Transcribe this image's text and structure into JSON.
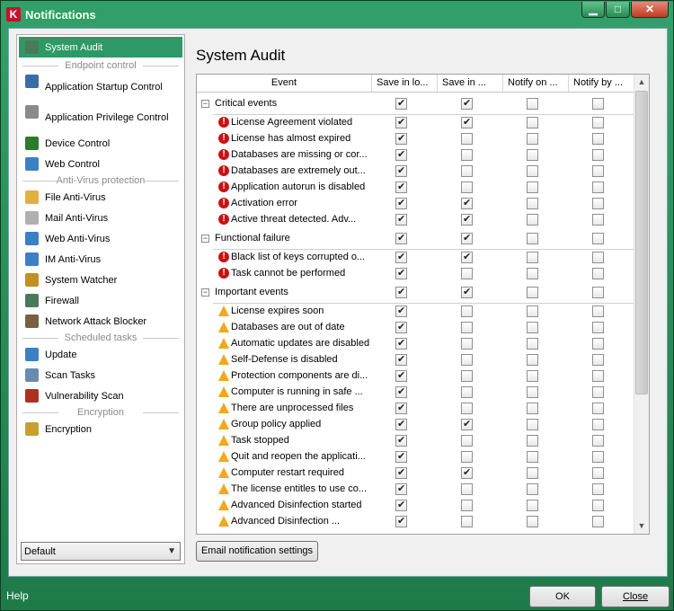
{
  "window": {
    "title": "Notifications",
    "icon": "kaspersky-k-icon"
  },
  "sidebar": {
    "items": [
      {
        "label": "System Audit",
        "icon": "shield-icon",
        "selected": true
      },
      {
        "section": "Endpoint control"
      },
      {
        "label": "Application Startup Control",
        "icon": "window-icon"
      },
      {
        "label": "Application Privilege Control",
        "icon": "funnel-icon"
      },
      {
        "label": "Device Control",
        "icon": "chip-icon"
      },
      {
        "label": "Web Control",
        "icon": "globe-lock-icon"
      },
      {
        "section": "Anti-Virus protection"
      },
      {
        "label": "File Anti-Virus",
        "icon": "folder-icon"
      },
      {
        "label": "Mail Anti-Virus",
        "icon": "envelope-icon"
      },
      {
        "label": "Web Anti-Virus",
        "icon": "globe-icon"
      },
      {
        "label": "IM Anti-Virus",
        "icon": "chat-icon"
      },
      {
        "label": "System Watcher",
        "icon": "shield-watch-icon"
      },
      {
        "label": "Firewall",
        "icon": "firewall-icon"
      },
      {
        "label": "Network Attack Blocker",
        "icon": "monitor-network-icon"
      },
      {
        "section": "Scheduled tasks"
      },
      {
        "label": "Update",
        "icon": "globe-update-icon"
      },
      {
        "label": "Scan Tasks",
        "icon": "scan-icon"
      },
      {
        "label": "Vulnerability Scan",
        "icon": "shield-scan-icon"
      },
      {
        "section": "Encryption"
      },
      {
        "label": "Encryption",
        "icon": "lock-icon"
      }
    ],
    "profile_select": {
      "value": "Default"
    }
  },
  "main": {
    "title": "System Audit",
    "columns": [
      "Event",
      "Save in lo...",
      "Save in ...",
      "Notify on ...",
      "Notify by ..."
    ],
    "rows": [
      {
        "type": "group",
        "label": "Critical events",
        "c": [
          true,
          true,
          false,
          false
        ]
      },
      {
        "type": "crit",
        "label": "License Agreement violated",
        "c": [
          true,
          true,
          false,
          false
        ]
      },
      {
        "type": "crit",
        "label": "License has almost expired",
        "c": [
          true,
          false,
          false,
          false
        ]
      },
      {
        "type": "crit",
        "label": "Databases are missing or cor...",
        "c": [
          true,
          false,
          false,
          false
        ]
      },
      {
        "type": "crit",
        "label": "Databases are extremely out...",
        "c": [
          true,
          false,
          false,
          false
        ]
      },
      {
        "type": "crit",
        "label": "Application autorun is disabled",
        "c": [
          true,
          false,
          false,
          false
        ]
      },
      {
        "type": "crit",
        "label": "Activation error",
        "c": [
          true,
          true,
          false,
          false
        ]
      },
      {
        "type": "crit",
        "label": "Active threat detected. Adv...",
        "c": [
          true,
          true,
          false,
          false
        ]
      },
      {
        "type": "group",
        "label": "Functional failure",
        "c": [
          true,
          true,
          false,
          false
        ]
      },
      {
        "type": "crit",
        "label": "Black list of keys corrupted o...",
        "c": [
          true,
          true,
          false,
          false
        ]
      },
      {
        "type": "crit",
        "label": "Task cannot be performed",
        "c": [
          true,
          false,
          false,
          false
        ]
      },
      {
        "type": "group",
        "label": "Important events",
        "c": [
          true,
          true,
          false,
          false
        ]
      },
      {
        "type": "warn",
        "label": "License expires soon",
        "c": [
          true,
          false,
          false,
          false
        ]
      },
      {
        "type": "warn",
        "label": "Databases are out of date",
        "c": [
          true,
          false,
          false,
          false
        ]
      },
      {
        "type": "warn",
        "label": "Automatic updates are disabled",
        "c": [
          true,
          false,
          false,
          false
        ]
      },
      {
        "type": "warn",
        "label": "Self-Defense is disabled",
        "c": [
          true,
          false,
          false,
          false
        ]
      },
      {
        "type": "warn",
        "label": "Protection components are di...",
        "c": [
          true,
          false,
          false,
          false
        ]
      },
      {
        "type": "warn",
        "label": "Computer is running in safe ...",
        "c": [
          true,
          false,
          false,
          false
        ]
      },
      {
        "type": "warn",
        "label": "There are unprocessed files",
        "c": [
          true,
          false,
          false,
          false
        ]
      },
      {
        "type": "warn",
        "label": "Group policy applied",
        "c": [
          true,
          true,
          false,
          false
        ]
      },
      {
        "type": "warn",
        "label": "Task stopped",
        "c": [
          true,
          false,
          false,
          false
        ]
      },
      {
        "type": "warn",
        "label": "Quit and reopen the applicati...",
        "c": [
          true,
          false,
          false,
          false
        ]
      },
      {
        "type": "warn",
        "label": "Computer restart required",
        "c": [
          true,
          true,
          false,
          false
        ]
      },
      {
        "type": "warn",
        "label": "The license entitles to use co...",
        "c": [
          true,
          false,
          false,
          false
        ]
      },
      {
        "type": "warn",
        "label": "Advanced Disinfection started",
        "c": [
          true,
          false,
          false,
          false
        ]
      },
      {
        "type": "warn",
        "label": "Advanced Disinfection  ...",
        "c": [
          true,
          false,
          false,
          false
        ]
      }
    ],
    "email_button": "Email notification settings"
  },
  "footer": {
    "help": "Help",
    "ok": "OK",
    "close": "Close"
  },
  "colors": {
    "accent": "#2e9966",
    "frame": "#2a8a56",
    "crit": "#cc1111",
    "warn": "#f0a81c"
  }
}
